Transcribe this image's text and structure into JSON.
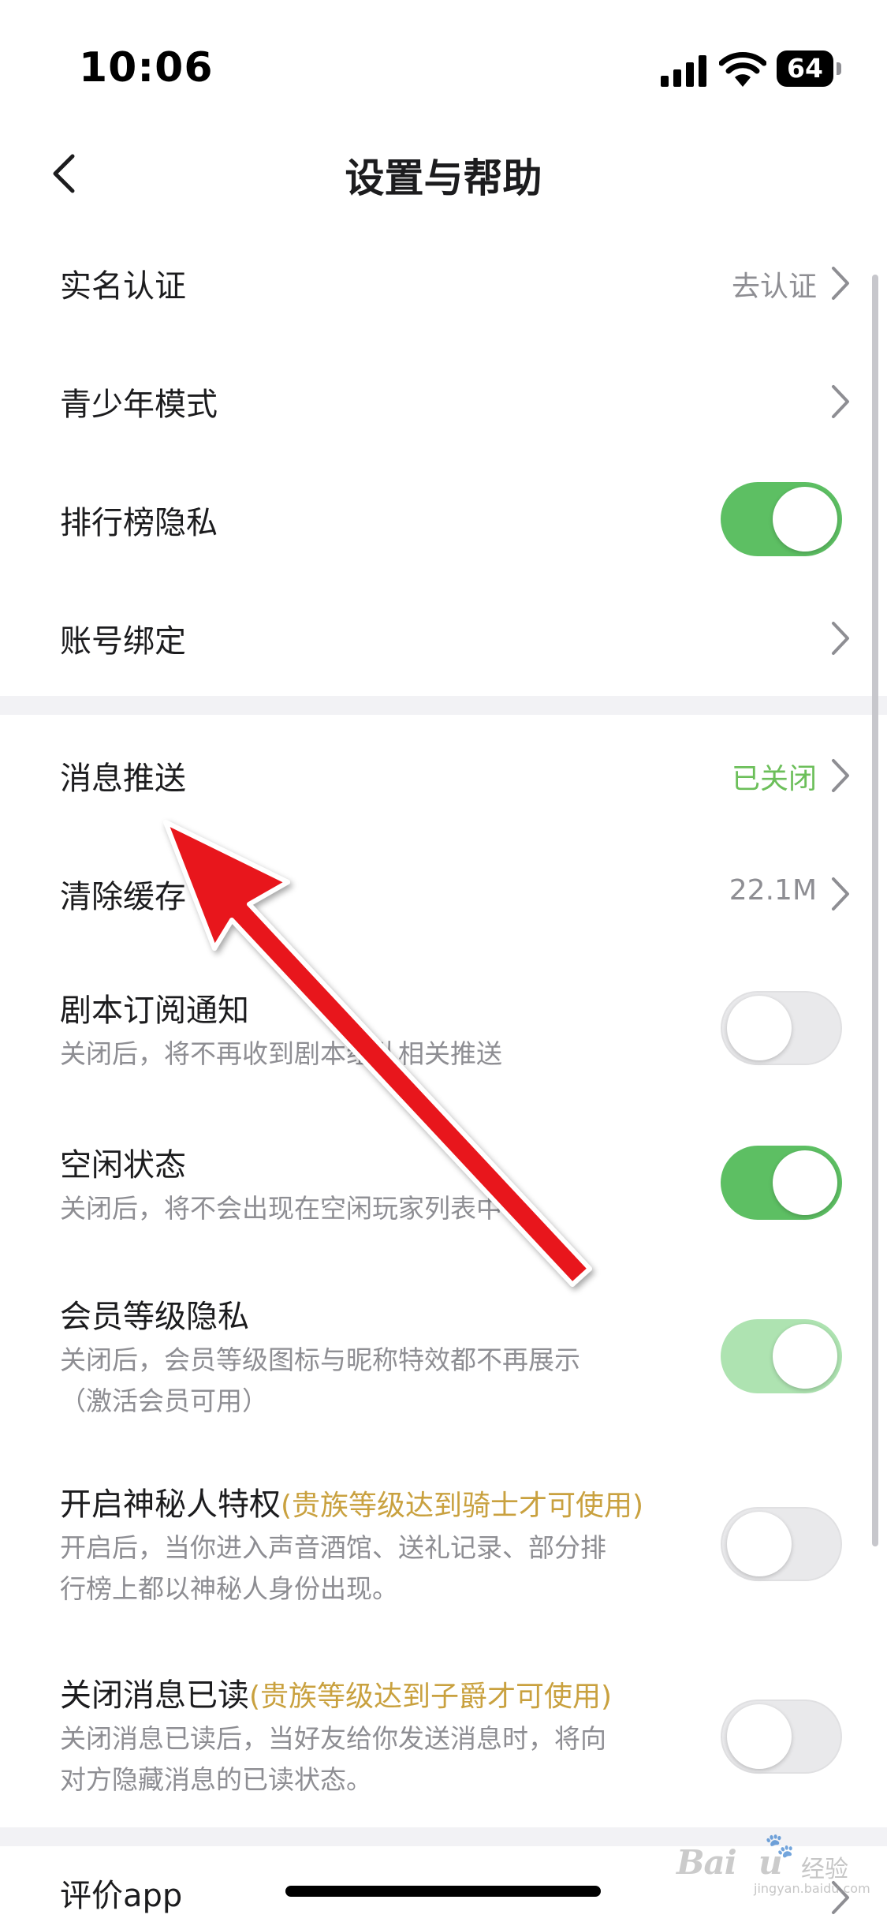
{
  "status_bar": {
    "time": "10:06",
    "battery": "64"
  },
  "nav": {
    "title": "设置与帮助"
  },
  "rows": [
    {
      "title": "实名认证",
      "value": "去认证",
      "control": "chevron"
    },
    {
      "title": "青少年模式",
      "control": "chevron"
    },
    {
      "title": "排行榜隐私",
      "control": "toggle",
      "on": true
    },
    {
      "title": "账号绑定",
      "control": "chevron"
    },
    {
      "title": "消息推送",
      "value": "已关闭",
      "value_color": "#6cbf5a",
      "control": "chevron"
    },
    {
      "title": "清除缓存",
      "value": "22.1M",
      "control": "chevron"
    },
    {
      "title": "剧本订阅通知",
      "subtitle": "关闭后，将不再收到剧本组队相关推送",
      "control": "toggle",
      "on": false
    },
    {
      "title": "空闲状态",
      "subtitle": "关闭后，将不会出现在空闲玩家列表中",
      "control": "toggle",
      "on": true
    },
    {
      "title": "会员等级隐私",
      "subtitle_lines": [
        "关闭后，会员等级图标与昵称特效都不再展示",
        "（激活会员可用）"
      ],
      "control": "toggle",
      "on": true,
      "disabled": true
    },
    {
      "title": "开启神秘人特权",
      "badge": "(贵族等级达到骑士才可使用)",
      "subtitle_lines": [
        "开启后，当你进入声音酒馆、送礼记录、部分排",
        "行榜上都以神秘人身份出现。"
      ],
      "control": "toggle",
      "on": false
    },
    {
      "title": "关闭消息已读",
      "badge": "(贵族等级达到子爵才可使用)",
      "subtitle_lines": [
        "关闭消息已读后，当好友给你发送消息时，将向",
        "对方隐藏消息的已读状态。"
      ],
      "control": "toggle",
      "on": false
    },
    {
      "title": "评价app",
      "control": "chevron"
    }
  ],
  "watermark": {
    "brand": "Bai",
    "paw": "🐾",
    "brand_tail": "u",
    "suffix": "经验",
    "url": "jingyan.baidu.com"
  },
  "colors": {
    "toggle_on": "#5dbf63",
    "toggle_disabled": "#aee3b1",
    "toggle_off": "#e9e9eb",
    "badge_gold": "#c9a13f",
    "annotation_arrow": "#e8171c"
  },
  "icons": {
    "back": "chevron-left-icon",
    "row_arrow": "chevron-right-icon"
  }
}
